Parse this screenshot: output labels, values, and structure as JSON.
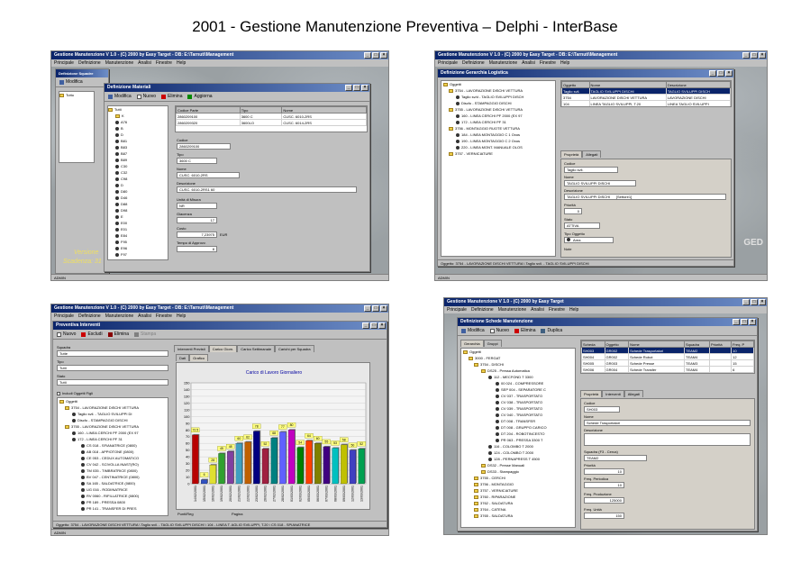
{
  "page_title": "2001 - Gestione Manutenzione Preventiva – Delphi - InterBase",
  "app": {
    "title": "Gestione Manutenzione V 1.0 - (C) 2000 by Easy Target - DB: E:\\Tarnuti\\Management",
    "title_short": "Gestione Manutenzione V 1.0 - (C) 2000 by Easy Target",
    "menu": [
      "Principale",
      "Definizione",
      "Manutenzione",
      "Analisi",
      "Finestre",
      "Help"
    ],
    "status_user": "ADMIN"
  },
  "win1": {
    "bg_window_title": "Definizione Squadre",
    "bg_toolbar": "Modifica",
    "bg_tree_root": "Tutto",
    "bg_text1": "Versione",
    "bg_text2": "Scadenza: 31",
    "mat_title": "Definizione Materiali",
    "toolbar": [
      "Modifica",
      "Nuovo",
      "Elimina",
      "Aggiorna"
    ],
    "tree_root": "Tutti",
    "tree_items": [
      "K",
      "A76",
      "B",
      "D",
      "B81",
      "B83",
      "B87",
      "B89",
      "C30",
      "C32",
      "C98",
      "D",
      "D80",
      "D46",
      "D88",
      "D98",
      "E",
      "E00",
      "E01",
      "E84",
      "F95",
      "E96",
      "F97"
    ],
    "grid_headers": [
      "Codice Parte",
      "Tipo",
      "Nome"
    ],
    "grid_rows": [
      [
        "2860209100",
        "3600 C",
        "CUSC. 6010-2RS"
      ],
      [
        "2860209320",
        "3600LO",
        "CUSC. 6014-2RS"
      ]
    ],
    "labels": {
      "codice": "Codice",
      "tipo": "Tipo",
      "nome": "Nome",
      "descrizione": "Descrizione",
      "unita": "Unità di Misura",
      "giacenza": "Giacenza",
      "costo": "Costo",
      "tempo": "Tempo di Approvv."
    },
    "values": {
      "codice": "2860209100",
      "tipo": "3600 C",
      "nome": "CUSC. 6010-2RS",
      "descrizione": "CUSC. 6010-2RS1     60",
      "unita": "NR",
      "giacenza": "17",
      "costo": "7,23975",
      "valuta": "EUR",
      "tempo": "8"
    }
  },
  "win2": {
    "sub_title": "Definizione Gerarchia Logistica",
    "tree": [
      "Oggetti",
      "3754 - LAVORAZIONE DISCHI VETTURA",
      "Taglio sv/d - TAGLIO SVILUPPI DISCH",
      "Discfo - STAMPAGGIO DISCHI",
      "3755 - LAVORAZIONE DISCHI VETTURA",
      "160 - LINEA CERCHI PF 2000 (EX 97",
      "172 - LINEA CERCHI PF 31",
      "3756 - MONTAGGIO RUOTE VETTURA",
      "184 - LINEA MONTAGGIO C 1 Oxos",
      "190 - LINEA MONTAGGIO C 2 Oxos",
      "220 - LINEA MONT. MANUALE OLOS",
      "3757 - VERNICIATURE"
    ],
    "grid_headers": [
      "Oggetto",
      "Nome",
      "Descrizione"
    ],
    "grid_rows": [
      [
        "Taglio svil.",
        "TAGLIO SVILUPPI DISCHI",
        "TAGLIO SVILUPPI DISCH"
      ],
      [
        "3754",
        "LAVORAZIONE DISCHI VETTURA",
        "LAVORAZIONE DISCHI"
      ],
      [
        "104",
        "LINEA TAGLIO SVILUPPI, T.20",
        "LINEA TAGLIO SVILUPPI"
      ]
    ],
    "tabs": [
      "Proprietà",
      "Allegati"
    ],
    "labels": {
      "codice": "Codice",
      "nome": "Nome",
      "descrizione": "Descrizione",
      "priorita": "Priorità",
      "stato": "Stato",
      "tipo": "Tipo Oggetto",
      "note": "Note"
    },
    "values": {
      "codice": "Taglio svil.",
      "nome": "TAGLIO SVILUPPI DISCHI",
      "descrizione": "TAGLIO SVILUPPI DISCHI",
      "descrizione2": "[Settore1]",
      "priorita": "0",
      "stato": "ATTIVA",
      "tipo": "Area"
    },
    "status": "Oggetto: 3754 - LAVORAZIONE DISCHI VETTURA \\ Taglio svil. - TAGLIO SVILUPPI DISCHI",
    "right_text": "GED"
  },
  "win3": {
    "sub_title": "Preventiva Interventi",
    "toolbar": [
      "Nuovo",
      "Escludi",
      "Elimina",
      "Stampa"
    ],
    "labels": {
      "squadra": "Squadra",
      "tipo": "Tipo",
      "stato": "Stato",
      "include": "Includi Oggetti Figli"
    },
    "values": {
      "squadra": "Tutte",
      "tipo": "Tutti",
      "stato": "Tutti"
    },
    "tree": [
      "Oggetti",
      "3754 - LAVORAZIONE DISCHI VETTURA",
      "Taglio svil. - TAGLIO SVILUPPI DI",
      "Discfo - STAMPAGGIO DISCHI",
      "3755 - LAVORAZIONE DISCHI VETTURA",
      "160 - LINEA CERCHI PF 2000 (EX 97",
      "172 - LINEA CERCHI PF 31",
      "CS 018 - SFIANATRICE (0800)",
      "AB 018 - APPIOTONE (0800)",
      "CE 053 - CEDUX AUTOMATICO",
      "CV 042 - SCIVOLLA INAST(RO)",
      "TM 035 - TIMBRATRICE (0800)",
      "BV 047 - CENTINATRICE (0800)",
      "SA 165 - SALDATRICE (0800)",
      "UG 016 - RODIINATRICE",
      "RV 0060 - RIFILLATRICE (0800)",
      "PR 189 - PRESSA 0800",
      "PR 141 - TRANSFER DI PRES"
    ],
    "tabs": [
      "Interventi Previsti",
      "Carico Giorn.",
      "Carico Settimanale",
      "Carichi per Squadra"
    ],
    "subtabs": [
      "Dati",
      "Grafico"
    ],
    "bottom_left": "Punti/Reg",
    "bottom_mid": "Pagina",
    "status": "Oggetto: 3754 - LAVORAZIONE DISCHI VETTURA \\ Taglio svil. - TAGLIO SVILUPPI DISCHI \\ 104 - LINEA T. AGLIO SVILUPPI, T.20 \\ CS 018 - SPIANATRICE"
  },
  "chart_data": {
    "type": "bar",
    "title": "Carico di Lavoro Giornaliero",
    "categories": [
      "14/02/2001",
      "15/02/2001",
      "16/02/2001",
      "19/02/2001",
      "20/02/2001",
      "21/02/2001",
      "22/02/2001",
      "23/02/2001",
      "26/02/2001",
      "27/02/2001",
      "28/02/2001",
      "01/03/2001",
      "02/03/2001",
      "05/03/2001",
      "06/03/2001",
      "07/03/2001",
      "08/03/2001",
      "09/03/2001",
      "12/03/2001",
      "13/03/2001"
    ],
    "values": [
      72.5,
      6,
      28,
      45,
      48,
      60,
      62,
      78,
      52,
      68,
      77,
      80,
      54,
      64,
      60,
      55,
      53,
      58,
      50,
      52
    ],
    "value_labels": [
      "72.5",
      "6",
      "28",
      "45",
      "48",
      "60",
      "62",
      "78",
      "52",
      "68",
      "77",
      "80",
      "54",
      "64",
      "60",
      "55",
      "53",
      "58",
      "50",
      "52"
    ],
    "ylim": [
      0,
      150
    ],
    "yticks": [
      0,
      10,
      20,
      30,
      40,
      50,
      60,
      70,
      80,
      90,
      100,
      110,
      120,
      130,
      140,
      150
    ],
    "colors": [
      "#b80000",
      "#3050c0",
      "#e0e030",
      "#30a030",
      "#8040a0",
      "#40a0c0",
      "#c06000",
      "#000080",
      "#a02040",
      "#008080",
      "#6060ff",
      "#c000c0",
      "#008000",
      "#ff4000",
      "#808000",
      "#400080",
      "#00c0c0",
      "#c0c000",
      "#4040c0",
      "#00a050"
    ],
    "grid": true
  },
  "win4": {
    "sub_title": "Definizione Schede Manutenzione",
    "toolbar": [
      "Modifica",
      "Nuovo",
      "Elimina",
      "Duplica"
    ],
    "left_tabs": [
      "Gerarchia",
      "Gruppi"
    ],
    "tree": [
      "Oggetti",
      "3000 - FERGAT",
      "3754 - DISCHI",
      "DS25 - Pressa Automatica",
      "112 - MECFOND T 3300",
      "00 024 - COMPRESSORE",
      "SEP 004 - SEPARATORE C",
      "CV 037 - TRASPORTATO",
      "CV 038 - TRASPORTATO",
      "CV 039 - TRASPORTATO",
      "CV 040 - TRASPORTATO",
      "DT 008 - TRANSFER",
      "DT 008 - GRUPPO CARICO",
      "DT 204 - ROBOTINCESTO",
      "PR 063 - PRESSA 3300 T",
      "116 - COLOMBO T 2000",
      "124 - COLOMBO T 2000",
      "128 - PERNAPRESS T 4500",
      "DS32 - Presse Manuali",
      "DS33 - Stampaggio",
      "3755 - CERCHI",
      "3756 - MONTAGGIO",
      "3757 - VERNICIATURE",
      "3760 - RIPARAZIONE",
      "3762 - SALDATURA",
      "3764 - CATENA",
      "3765 - SALDATURA"
    ],
    "grid_headers": [
      "Scheda",
      "Oggetto",
      "Nome",
      "Squadra",
      "Priorità",
      "Freq. P"
    ],
    "grid_rows": [
      [
        "SH003",
        "GR002",
        "Schede Trasportatori",
        "TEAM2",
        "",
        "10"
      ],
      [
        "SH004",
        "GR002",
        "Schede Robot",
        "TEAM4",
        "",
        "12"
      ],
      [
        "SH005",
        "GR003",
        "Schede Presse",
        "TEAM3",
        "",
        "15"
      ],
      [
        "SH006",
        "GR004",
        "Schede Transfer",
        "TEAM4",
        "",
        "6"
      ]
    ],
    "tabs": [
      "Proprietà",
      "Interventi",
      "Allegati"
    ],
    "labels": {
      "codice": "Codice",
      "nome": "Nome",
      "descrizione": "Descrizione",
      "squadra": "Squadra (F3 - Cerca)",
      "priorita": "Priorità",
      "freq_per": "Freq. Periodica",
      "freq_prod": "Freq. Produzione",
      "freq_ore": "Freq. Unità"
    },
    "values": {
      "codice": "SH003",
      "nome": "Schede Trasportatori",
      "descrizione": "",
      "squadra": "TEAM2",
      "priorita": "10",
      "freq_per": "10",
      "freq_prod": "125000",
      "freq_ore": "150"
    }
  }
}
